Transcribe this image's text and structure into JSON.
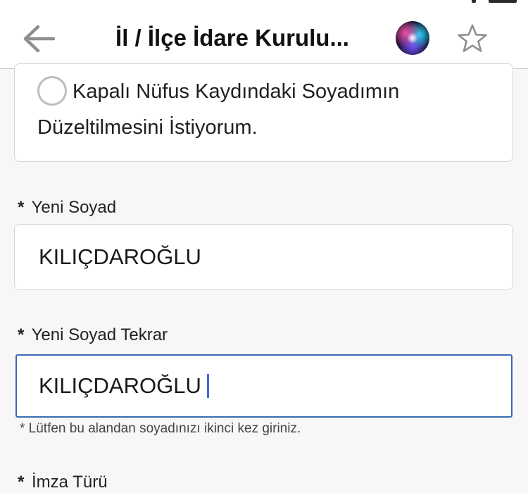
{
  "header": {
    "title": "İl / İlçe İdare Kurulu...",
    "back_icon": "arrow-left-icon",
    "siri_icon": "siri-icon",
    "favorite_icon": "star-outline-icon"
  },
  "form": {
    "radio_option": {
      "label": "Kapalı Nüfus Kaydındaki Soyadımın Düzeltilmesini İstiyorum.",
      "selected": false
    },
    "new_surname": {
      "required_mark": "*",
      "label": "Yeni Soyad",
      "value": "KILIÇDAROĞLU"
    },
    "new_surname_repeat": {
      "required_mark": "*",
      "label": "Yeni Soyad Tekrar",
      "value": "KILIÇDAROĞLU",
      "hint": "* Lütfen bu alandan soyadınızı ikinci kez giriniz."
    },
    "signature_type": {
      "required_mark": "*",
      "label": "İmza Türü"
    }
  },
  "colors": {
    "focus_border": "#3a6bb3",
    "caret": "#3a6fe0",
    "icon_gray": "#8e8e93"
  }
}
